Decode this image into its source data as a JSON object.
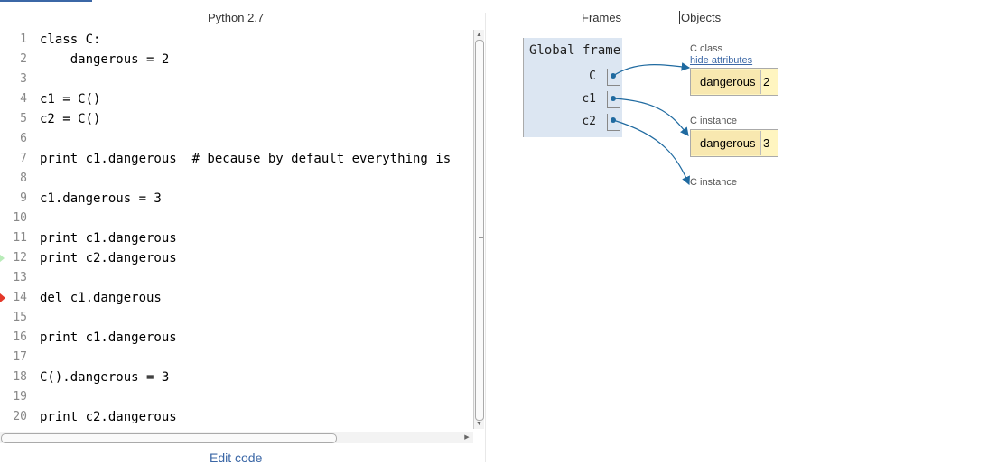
{
  "header": {
    "language": "Python 2.7"
  },
  "editor": {
    "lines": [
      {
        "num": "1",
        "code": "class C:"
      },
      {
        "num": "2",
        "code": "    dangerous = 2"
      },
      {
        "num": "3",
        "code": ""
      },
      {
        "num": "4",
        "code": "c1 = C()"
      },
      {
        "num": "5",
        "code": "c2 = C()"
      },
      {
        "num": "6",
        "code": ""
      },
      {
        "num": "7",
        "code": "print c1.dangerous  # because by default everything is"
      },
      {
        "num": "8",
        "code": ""
      },
      {
        "num": "9",
        "code": "c1.dangerous = 3"
      },
      {
        "num": "10",
        "code": ""
      },
      {
        "num": "11",
        "code": "print c1.dangerous"
      },
      {
        "num": "12",
        "code": "print c2.dangerous"
      },
      {
        "num": "13",
        "code": ""
      },
      {
        "num": "14",
        "code": "del c1.dangerous"
      },
      {
        "num": "15",
        "code": ""
      },
      {
        "num": "16",
        "code": "print c1.dangerous"
      },
      {
        "num": "17",
        "code": ""
      },
      {
        "num": "18",
        "code": "C().dangerous = 3"
      },
      {
        "num": "19",
        "code": ""
      },
      {
        "num": "20",
        "code": "print c2.dangerous"
      }
    ],
    "next_line": "12",
    "current_line": "14",
    "edit_code_label": "Edit code"
  },
  "viz": {
    "frames_header": "Frames",
    "objects_header": "Objects",
    "global_frame": {
      "title": "Global frame",
      "vars": [
        "C",
        "c1",
        "c2"
      ]
    },
    "objects": [
      {
        "label": "C class",
        "link": "hide attributes",
        "key": "dangerous",
        "value": "2"
      },
      {
        "label": "C instance",
        "key": "dangerous",
        "value": "3"
      },
      {
        "label": "C instance"
      }
    ],
    "colors": {
      "arrow": "#1f6aa0",
      "frame_bg": "#dce6f2",
      "object_bg": "#fff5c0",
      "current_line_arrow": "#e4382a",
      "next_line_arrow": "#b9ecb9"
    }
  }
}
